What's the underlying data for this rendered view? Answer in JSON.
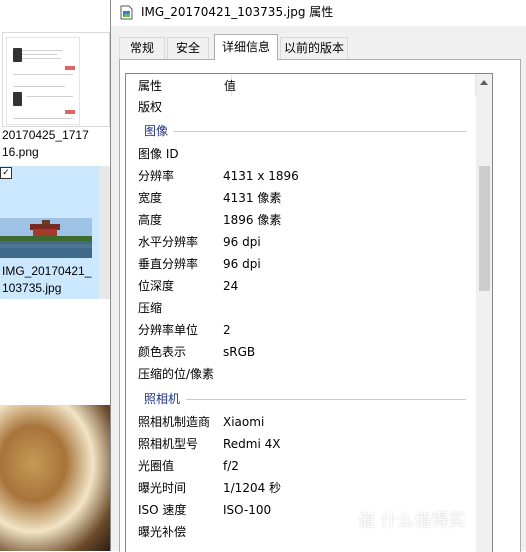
{
  "explorer": {
    "items": [
      {
        "filename_line1": "20170425_1717",
        "filename_line2": "16.png"
      },
      {
        "filename_line1": "IMG_20170421_",
        "filename_line2": "103735.jpg"
      }
    ],
    "checkbox_glyph": "✓"
  },
  "window": {
    "title": "IMG_20170421_103735.jpg 属性",
    "tabs": [
      {
        "label": "常规"
      },
      {
        "label": "安全"
      },
      {
        "label": "详细信息"
      },
      {
        "label": "以前的版本"
      }
    ],
    "active_tab": "详细信息"
  },
  "details": {
    "header": {
      "property": "属性",
      "value": "值"
    },
    "first_row": {
      "name": "版权",
      "value": ""
    },
    "sections": [
      {
        "title": "图像",
        "rows": [
          {
            "name": "图像 ID",
            "value": ""
          },
          {
            "name": "分辨率",
            "value": "4131 x 1896"
          },
          {
            "name": "宽度",
            "value": "4131 像素"
          },
          {
            "name": "高度",
            "value": "1896 像素"
          },
          {
            "name": "水平分辨率",
            "value": "96 dpi"
          },
          {
            "name": "垂直分辨率",
            "value": "96 dpi"
          },
          {
            "name": "位深度",
            "value": "24"
          },
          {
            "name": "压缩",
            "value": ""
          },
          {
            "name": "分辨率单位",
            "value": "2"
          },
          {
            "name": "颜色表示",
            "value": "sRGB"
          },
          {
            "name": "压缩的位/像素",
            "value": ""
          }
        ]
      },
      {
        "title": "照相机",
        "rows": [
          {
            "name": "照相机制造商",
            "value": "Xiaomi"
          },
          {
            "name": "照相机型号",
            "value": "Redmi 4X"
          },
          {
            "name": "光圈值",
            "value": "f/2"
          },
          {
            "name": "曝光时间",
            "value": "1/1204 秒"
          },
          {
            "name": "ISO 速度",
            "value": "ISO-100"
          },
          {
            "name": "曝光补偿",
            "value": ""
          }
        ]
      }
    ]
  },
  "watermark": {
    "text": "值 什么值得买"
  },
  "colors": {
    "selection": "#cce8ff",
    "section_title": "#1e3287",
    "border": "#adadad"
  }
}
